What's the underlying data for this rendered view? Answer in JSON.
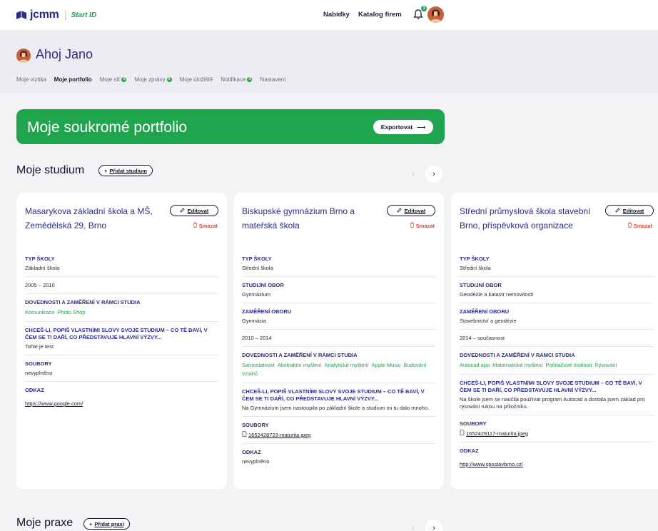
{
  "topbar": {
    "logo_text": "jcmm",
    "logo_start": "Start ID",
    "nav": [
      "Nabídky",
      "Katalog firem"
    ],
    "notif_count": "3"
  },
  "header": {
    "greeting": "Ahoj Jano",
    "tabs": [
      {
        "label": "Moje vizitka",
        "badge": ""
      },
      {
        "label": "Moje portfolio",
        "badge": "",
        "active": true
      },
      {
        "label": "Moje síť",
        "badge": "0"
      },
      {
        "label": "Moje zprávy",
        "badge": "0"
      },
      {
        "label": "Moje úložiště",
        "badge": ""
      },
      {
        "label": "Notifikace",
        "badge": "3"
      },
      {
        "label": "Nastavení",
        "badge": ""
      }
    ]
  },
  "banner": {
    "title": "Moje soukromé portfolio",
    "export_label": "Exportovat",
    "export_arrow": "⟶"
  },
  "studium": {
    "title": "Moje studium",
    "add_label": "Přidat studium",
    "add_icon": "+"
  },
  "praxe": {
    "title": "Moje praxe",
    "add_label": "Přidat praxi",
    "add_icon": "+"
  },
  "card_actions": {
    "edit_label": "Editovat",
    "delete_label": "Smazat"
  },
  "cards": [
    {
      "title": "Masarykova základní škola a MŠ, Zemědělská 29, Brno",
      "fields": {
        "typ_label": "TYP ŠKOLY",
        "typ_value": "Základní škola",
        "period": "2005 – 2010",
        "skills_label": "DOVEDNOSTI A ZAMĚŘENÍ V RÁMCI STUDIA",
        "skills": [
          "Komunikace",
          "Photo Shop"
        ],
        "desc_label": "CHCEŠ-LI, POPIŠ VLASTNÍMI SLOVY SVOJE STUDIUM – CO TĚ BAVÍ, V ČEM SE TI DAŘÍ, CO PŘEDSTAVUJE HLAVNÍ VÝZVY...",
        "desc_value": "Tohle je test",
        "files_label": "SOUBORY",
        "files_value": "nevyplněno",
        "link_label": "ODKAZ",
        "link_value": "https://www.google.com/"
      }
    },
    {
      "title": "Biskupské gymnázium Brno a mateřská škola",
      "fields": {
        "typ_label": "TYP ŠKOLY",
        "typ_value": "Střední škola",
        "obor_label": "STUDIJNÍ OBOR",
        "obor_value": "Gymnázium",
        "zamereni_label": "ZAMĚŘENÍ OBORU",
        "zamereni_value": "Gymnázia",
        "period": "2010 – 2014",
        "skills_label": "DOVEDNOSTI A ZAMĚŘENÍ V RÁMCI STUDIA",
        "skills": [
          "Samostatnost",
          "Abstraktní myšlení",
          "Analytické myšlení",
          "Apple Music",
          "Budování vztahů"
        ],
        "desc_label": "CHCEŠ-LI, POPIŠ VLASTNÍMI SLOVY SVOJE STUDIUM – CO TĚ BAVÍ, V ČEM SE TI DAŘÍ, CO PŘEDSTAVUJE HLAVNÍ VÝZVY...",
        "desc_value": "Na Gymnázium jsem nastoupila po základní škole a studium mi tu dalo mnoho.",
        "files_label": "SOUBORY",
        "file_name": "1652428723-maturita.jpeg",
        "link_label": "ODKAZ",
        "link_value": "nevyplněno"
      }
    },
    {
      "title": "Střední průmyslová škola stavební Brno, příspěvková organizace",
      "fields": {
        "typ_label": "TYP ŠKOLY",
        "typ_value": "Střední škola",
        "obor_label": "STUDIJNÍ OBOR",
        "obor_value": "Geodézie a katastr nemovitostí",
        "zamereni_label": "ZAMĚŘENÍ OBORU",
        "zamereni_value": "Stavebnictví a geodézie",
        "period": "2014 – současnost",
        "skills_label": "DOVEDNOSTI A ZAMĚŘENÍ V RÁMCI STUDIA",
        "skills": [
          "Autocad app",
          "Matematické myšlení",
          "Počítačové znalosti",
          "Rýsování"
        ],
        "desc_label": "CHCEŠ-LI, POPIŠ VLASTNÍMI SLOVY SVOJE STUDIUM – CO TĚ BAVÍ, V ČEM SE TI DAŘÍ, CO PŘEDSTAVUJE HLAVNÍ VÝZVY...",
        "desc_value": "Na škole jsem se naučila používat program Autocad a dostala jsem základ pro rýsování rukou na přiložníku.",
        "files_label": "SOUBORY",
        "file_name": "1652429117-maturita.jpeg",
        "link_label": "ODKAZ",
        "link_value": "http://www.spsstavbrno.cz/"
      }
    }
  ],
  "colors": {
    "brand": "#2b2b8a",
    "green": "#1fa54d",
    "danger": "#e0463e"
  },
  "icons": [
    "bell-icon",
    "pencil-icon",
    "trash-icon",
    "file-icon",
    "chevron-left-icon",
    "chevron-right-icon",
    "arrow-right-icon"
  ]
}
